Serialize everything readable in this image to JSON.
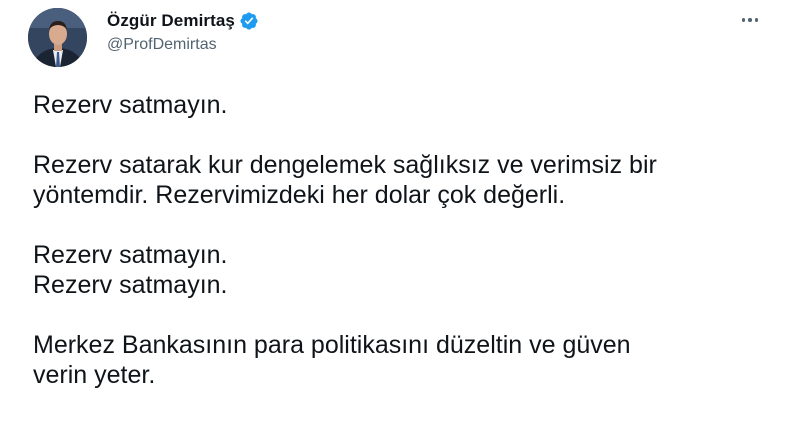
{
  "author": {
    "display_name": "Özgür Demirtaş",
    "handle": "@ProfDemirtas",
    "verified": true,
    "verified_color": "#1d9bf0"
  },
  "icons": {
    "verified": "verified-badge-icon",
    "more": "more-options-icon"
  },
  "tweet": {
    "p1": "Rezerv satmayın.",
    "p2_line1": "Rezerv satarak kur dengelemek sağlıksız ve verimsiz bir",
    "p2_line2": "yöntemdir. Rezervimizdeki her dolar çok değerli.",
    "p3_line1": "Rezerv satmayın.",
    "p3_line2": "Rezerv satmayın.",
    "p4_line1": "Merkez Bankasının para politikasını düzeltin ve güven",
    "p4_line2": "verin yeter."
  }
}
